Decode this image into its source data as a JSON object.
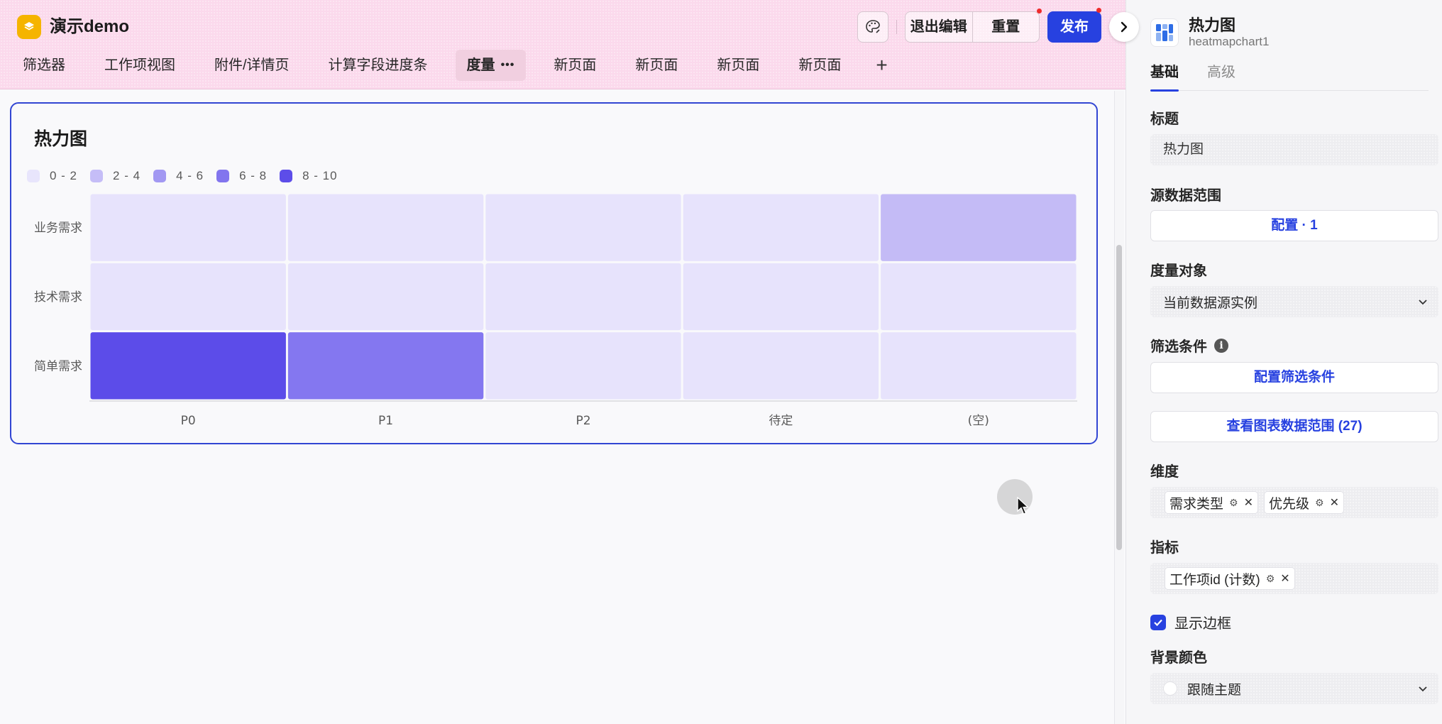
{
  "app": {
    "title": "演示demo"
  },
  "header": {
    "exit_edit_label": "退出编辑",
    "reset_label": "重置",
    "publish_label": "发布"
  },
  "tabs": [
    {
      "label": "筛选器"
    },
    {
      "label": "工作项视图"
    },
    {
      "label": "附件/详情页"
    },
    {
      "label": "计算字段进度条"
    },
    {
      "label": "度量",
      "active": true
    },
    {
      "label": "新页面"
    },
    {
      "label": "新页面"
    },
    {
      "label": "新页面"
    },
    {
      "label": "新页面"
    }
  ],
  "tab_add_label": "+",
  "tab_more_label": "•••",
  "chart_data": {
    "type": "heatmap",
    "title": "热力图",
    "x_categories": [
      "P0",
      "P1",
      "P2",
      "待定",
      "(空)"
    ],
    "y_categories": [
      "业务需求",
      "技术需求",
      "简单需求"
    ],
    "values": [
      [
        1,
        1,
        1,
        1,
        3
      ],
      [
        1,
        1,
        1,
        1,
        1
      ],
      [
        9,
        7,
        1,
        1,
        1
      ]
    ],
    "legend": [
      {
        "label": "0 - 2",
        "color": "#e8e5fc"
      },
      {
        "label": "2 - 4",
        "color": "#c5bdf7"
      },
      {
        "label": "4 - 6",
        "color": "#a298f2"
      },
      {
        "label": "6 - 8",
        "color": "#8275ee"
      },
      {
        "label": "8 - 10",
        "color": "#5d4de9"
      }
    ],
    "legend_position": "top-left",
    "grid": false
  },
  "panel": {
    "title": "热力图",
    "subtitle": "heatmapchart1",
    "tabs": [
      {
        "label": "基础",
        "active": true
      },
      {
        "label": "高级"
      }
    ],
    "title_label": "标题",
    "title_value": "热力图",
    "source_label": "源数据范围",
    "source_button": "配置 · 1",
    "measure_obj_label": "度量对象",
    "measure_obj_value": "当前数据源实例",
    "filter_label": "筛选条件",
    "filter_button": "配置筛选条件",
    "view_range_button": "查看图表数据范围 (27)",
    "dimension_label": "维度",
    "dimensions": [
      "需求类型",
      "优先级"
    ],
    "metric_label": "指标",
    "metrics": [
      "工作项id (计数)"
    ],
    "show_border_label": "显示边框",
    "show_border_checked": true,
    "bg_color_label": "背景颜色",
    "bg_color_value": "跟随主题"
  },
  "colors": {
    "accent": "#2741e0",
    "topbar": "#fbd9ec",
    "logo": "#f5b400"
  }
}
